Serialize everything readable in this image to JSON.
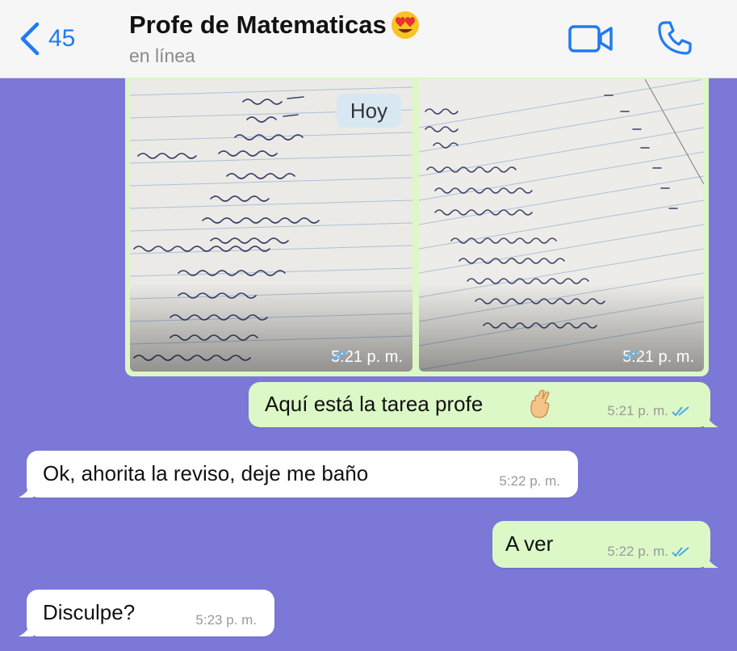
{
  "header": {
    "back_count": "45",
    "contact_name": "Profe de Matematicas",
    "status": "en línea",
    "video_icon": "video-camera-icon",
    "call_icon": "phone-icon",
    "name_emoji": "heart-eyes-emoji"
  },
  "date_chip": "Hoy",
  "photos": [
    {
      "time": "5:21 p. m.",
      "read_icon": "double-check-icon"
    },
    {
      "time": "5:21 p. m.",
      "read_icon": "double-check-icon"
    }
  ],
  "messages": [
    {
      "direction": "outgoing",
      "text": "Aquí está la tarea profe",
      "emoji": "crossed-fingers-emoji",
      "time": "5:21 p. m.",
      "read_icon": "double-check-icon"
    },
    {
      "direction": "incoming",
      "text": "Ok, ahorita la reviso, deje me baño",
      "time": "5:22 p. m."
    },
    {
      "direction": "outgoing",
      "text": "A ver",
      "time": "5:22 p. m.",
      "read_icon": "double-check-icon"
    },
    {
      "direction": "incoming",
      "text": "Disculpe?",
      "time": "5:23 p. m."
    }
  ],
  "colors": {
    "chat_background": "#7b78d8",
    "outgoing_bubble": "#dcf8c6",
    "incoming_bubble": "#ffffff",
    "accent": "#1f7bf2",
    "read_tick": "#4fa6e6"
  }
}
